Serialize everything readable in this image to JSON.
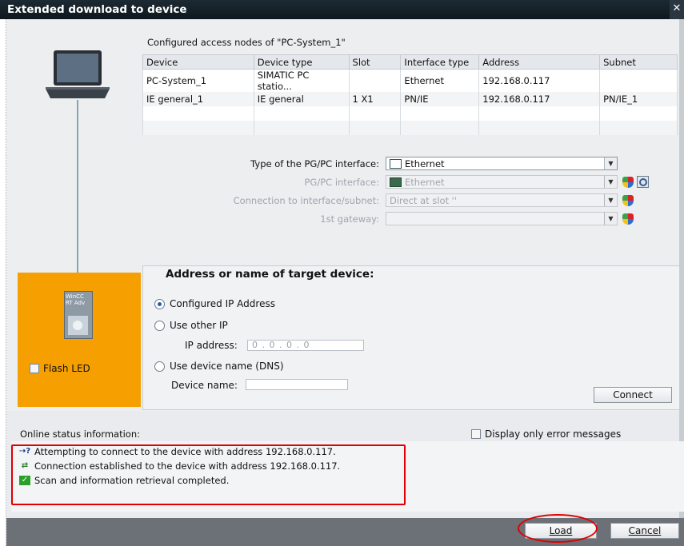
{
  "window": {
    "title": "Extended download to device"
  },
  "nodes": {
    "caption": "Configured access nodes of \"PC-System_1\"",
    "columns": [
      "Device",
      "Device type",
      "Slot",
      "Interface type",
      "Address",
      "Subnet"
    ],
    "rows": [
      [
        "PC-System_1",
        "SIMATIC PC statio...",
        "",
        "Ethernet",
        "192.168.0.117",
        ""
      ],
      [
        "IE general_1",
        "IE general",
        "1 X1",
        "PN/IE",
        "192.168.0.117",
        "PN/IE_1"
      ],
      [
        "",
        "",
        "",
        "",
        "",
        ""
      ],
      [
        "",
        "",
        "",
        "",
        "",
        ""
      ]
    ]
  },
  "interface": {
    "type_label": "Type of the PG/PC interface:",
    "type_value": "Ethernet",
    "pgpc_label": "PG/PC interface:",
    "pgpc_value": "Ethernet",
    "conn_label": "Connection to interface/subnet:",
    "conn_value": "Direct at slot ''",
    "gateway_label": "1st gateway:",
    "gateway_value": ""
  },
  "target": {
    "heading": "Address or name of target device:",
    "opt_configured": "Configured IP Address",
    "opt_other": "Use other IP",
    "ip_label": "IP address:",
    "ip_value": "0   . 0   . 0   . 0",
    "opt_dns": "Use device name (DNS)",
    "name_label": "Device name:",
    "connect": "Connect",
    "selected": "configured"
  },
  "device": {
    "label1": "WinCC",
    "label2": "RT Adv",
    "flash_led": "Flash LED"
  },
  "status": {
    "label": "Online status information:",
    "only_errors": "Display only error messages",
    "messages": [
      "Attempting to connect to the device with address 192.168.0.117.",
      "Connection established to the device with address 192.168.0.117.",
      "Scan and information retrieval completed."
    ]
  },
  "buttons": {
    "load": "Load",
    "cancel": "Cancel"
  },
  "colors": {
    "accent_orange": "#f5a000",
    "highlight_red": "#e00000",
    "title_bg": "#0e171d"
  },
  "icons": {
    "close": "close-icon",
    "laptop": "laptop-icon",
    "ethernet": "ethernet-icon",
    "shield": "shield-icon",
    "search": "search-icon",
    "connecting": "connecting-icon",
    "connected": "connected-icon",
    "check": "check-icon"
  }
}
